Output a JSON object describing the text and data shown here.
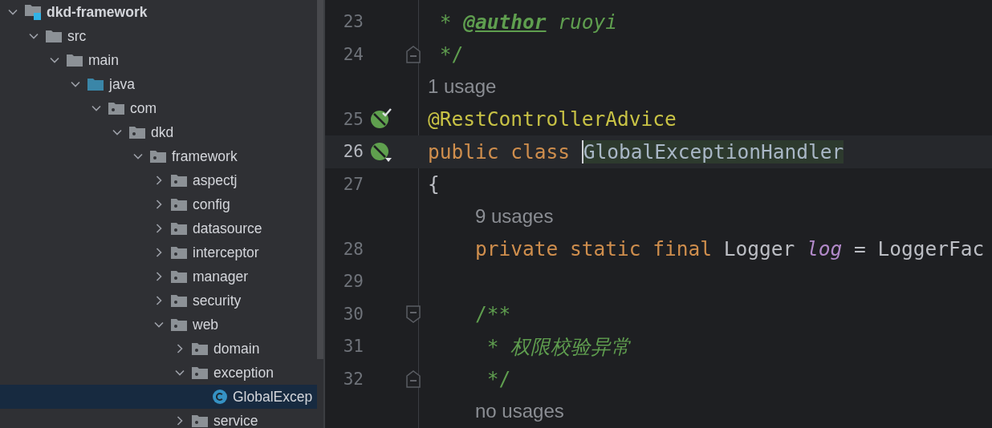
{
  "project_tree": [
    {
      "label": "dkd-framework",
      "kind": "module",
      "expanded": true,
      "selected": false,
      "children": [
        {
          "label": "src",
          "kind": "folder",
          "expanded": true,
          "selected": false,
          "children": [
            {
              "label": "main",
              "kind": "folder",
              "expanded": true,
              "selected": false,
              "children": [
                {
                  "label": "java",
                  "kind": "source",
                  "expanded": true,
                  "selected": false,
                  "children": [
                    {
                      "label": "com",
                      "kind": "package",
                      "expanded": true,
                      "selected": false,
                      "children": [
                        {
                          "label": "dkd",
                          "kind": "package",
                          "expanded": true,
                          "selected": false,
                          "children": [
                            {
                              "label": "framework",
                              "kind": "package",
                              "expanded": true,
                              "selected": false,
                              "children": [
                                {
                                  "label": "aspectj",
                                  "kind": "package",
                                  "expanded": false,
                                  "selected": false
                                },
                                {
                                  "label": "config",
                                  "kind": "package",
                                  "expanded": false,
                                  "selected": false
                                },
                                {
                                  "label": "datasource",
                                  "kind": "package",
                                  "expanded": false,
                                  "selected": false
                                },
                                {
                                  "label": "interceptor",
                                  "kind": "package",
                                  "expanded": false,
                                  "selected": false
                                },
                                {
                                  "label": "manager",
                                  "kind": "package",
                                  "expanded": false,
                                  "selected": false
                                },
                                {
                                  "label": "security",
                                  "kind": "package",
                                  "expanded": false,
                                  "selected": false
                                },
                                {
                                  "label": "web",
                                  "kind": "package",
                                  "expanded": true,
                                  "selected": false,
                                  "children": [
                                    {
                                      "label": "domain",
                                      "kind": "package",
                                      "expanded": false,
                                      "selected": false
                                    },
                                    {
                                      "label": "exception",
                                      "kind": "package",
                                      "expanded": true,
                                      "selected": false,
                                      "children": [
                                        {
                                          "label": "GlobalExcep",
                                          "kind": "class",
                                          "selected": true
                                        }
                                      ]
                                    },
                                    {
                                      "label": "service",
                                      "kind": "package",
                                      "expanded": false,
                                      "selected": false
                                    }
                                  ]
                                }
                              ]
                            }
                          ]
                        }
                      ]
                    }
                  ]
                }
              ]
            }
          ]
        }
      ]
    }
  ],
  "editor": {
    "lines": [
      {
        "number": "23",
        "kind": "doc",
        "tokens": [
          {
            "text": "*",
            "kind": "comment"
          },
          {
            "text": "@author",
            "kind": "doc-tag"
          },
          {
            "text": "ruoyi",
            "kind": "comment-italic"
          }
        ]
      },
      {
        "number": "24",
        "kind": "doc",
        "fold": {
          "kind": "end"
        },
        "tokens": [
          {
            "text": "*/",
            "kind": "comment"
          }
        ]
      },
      {
        "hint": "1 usage"
      },
      {
        "number": "25",
        "gutter_icon": {
          "kind": "check"
        },
        "tokens": [
          {
            "text": "@RestControllerAdvice",
            "kind": "annotation"
          }
        ]
      },
      {
        "number": "26",
        "gutter_icon": {
          "kind": "dropdown"
        },
        "current": true,
        "tokens": [
          {
            "text": "public",
            "kind": "keyword"
          },
          {
            "text": "class",
            "kind": "keyword"
          },
          {
            "text": "GlobalExceptionHandler",
            "kind": "class-name"
          }
        ]
      },
      {
        "number": "27",
        "tokens": [
          {
            "text": "{",
            "kind": "plain"
          }
        ],
        "children": [
          {
            "hint": "9 usages"
          },
          {
            "number": "28",
            "tokens": [
              {
                "text": "private",
                "kind": "keyword"
              },
              {
                "text": "static",
                "kind": "keyword"
              },
              {
                "text": "final",
                "kind": "keyword"
              },
              {
                "text": "Logger",
                "kind": "plain"
              },
              {
                "text": "log",
                "kind": "field"
              },
              {
                "text": "=",
                "kind": "plain"
              },
              {
                "text": "LoggerFac",
                "kind": "plain"
              }
            ]
          },
          {
            "number": "29"
          },
          {
            "number": "30",
            "fold": {
              "kind": "start"
            },
            "tokens": [
              {
                "text": "/**",
                "kind": "comment"
              }
            ]
          },
          {
            "number": "31",
            "kind": "doc",
            "tokens": [
              {
                "text": "*",
                "kind": "comment"
              },
              {
                "text": "权限校验异常",
                "kind": "comment-italic"
              }
            ]
          },
          {
            "number": "32",
            "kind": "doc",
            "fold": {
              "kind": "end"
            },
            "tokens": [
              {
                "text": "*/",
                "kind": "comment"
              }
            ]
          },
          {
            "hint": "no usages"
          }
        ]
      }
    ]
  }
}
